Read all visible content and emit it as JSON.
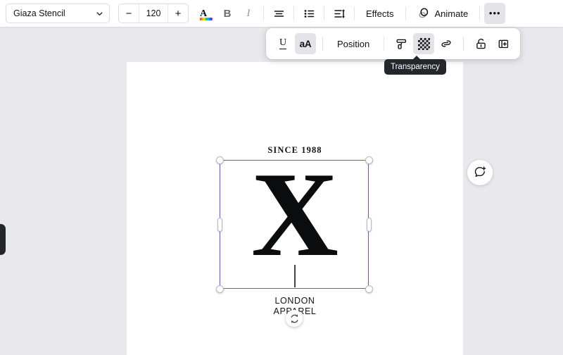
{
  "toolbar": {
    "font_name": "Giaza Stencil",
    "font_size": "120",
    "decrease_label": "−",
    "increase_label": "+",
    "text_color_glyph": "A",
    "bold_label": "B",
    "italic_label": "I",
    "effects_label": "Effects",
    "animate_label": "Animate",
    "more_label": "•••",
    "icons": {
      "align": "align-center-icon",
      "list": "bullet-list-icon",
      "spacing": "line-spacing-icon",
      "animate": "animate-icon",
      "chevron": "chevron-down-icon"
    }
  },
  "float_toolbar": {
    "underline_label": "U",
    "case_label": "aA",
    "position_label": "Position",
    "icons": {
      "paint_roller": "paint-roller-icon",
      "transparency": "transparency-icon",
      "link": "link-icon",
      "lock": "lock-icon",
      "duplicate": "duplicate-icon"
    }
  },
  "tooltip": {
    "text": "Transparency"
  },
  "canvas": {
    "design": {
      "tagline_top": "SINCE 1988",
      "monogram": "X",
      "tagline_bottom_line1": "LONDON",
      "tagline_bottom_line2": "APPAREL"
    }
  },
  "controls": {
    "rotate_icon": "rotate-icon",
    "comment_icon": "add-comment-icon",
    "panel_handle": "collapse-panel-handle"
  },
  "colors": {
    "selection": "#8b3dff",
    "canvas_bg": "#e9e9ed",
    "page_bg": "#ffffff",
    "tooltip_bg": "#23262b",
    "text": "#0e1318"
  }
}
